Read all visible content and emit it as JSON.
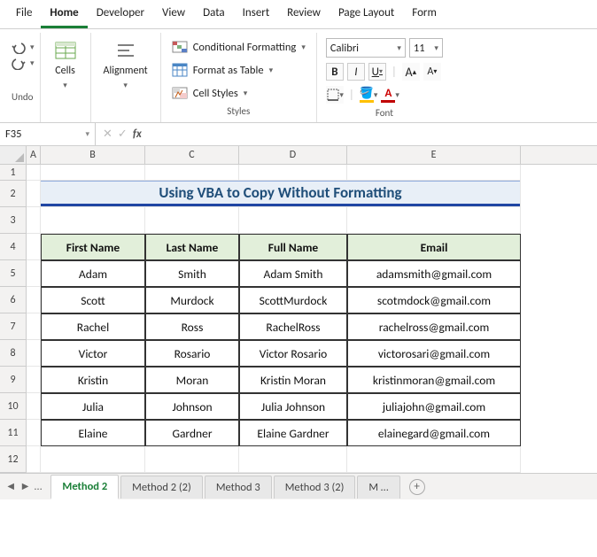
{
  "menu": [
    "File",
    "Home",
    "Developer",
    "View",
    "Data",
    "Insert",
    "Review",
    "Page Layout",
    "Form"
  ],
  "active_menu": "Home",
  "ribbon": {
    "undo": "Undo",
    "cells": "Cells",
    "alignment": "Alignment",
    "styles_label": "Styles",
    "cond_fmt": "Conditional Formatting",
    "fmt_table": "Format as Table",
    "cell_styles": "Cell Styles",
    "font_label": "Font",
    "font_name": "Calibri",
    "font_size": "11",
    "bold": "B",
    "italic": "I",
    "underline": "U"
  },
  "namebox": "F35",
  "columns": [
    "A",
    "B",
    "C",
    "D",
    "E"
  ],
  "row_nums": [
    "1",
    "2",
    "3",
    "4",
    "5",
    "6",
    "7",
    "8",
    "9",
    "10",
    "11",
    "12"
  ],
  "title": "Using VBA to Copy Without Formatting",
  "headers": [
    "First Name",
    "Last Name",
    "Full Name",
    "Email"
  ],
  "rows": [
    [
      "Adam",
      "Smith",
      "Adam Smith",
      "adamsmith@gmail.com"
    ],
    [
      "Scott",
      "Murdock",
      "ScottMurdock",
      "scotmdock@gmail.com"
    ],
    [
      "Rachel",
      "Ross",
      "RachelRoss",
      "rachelross@gmail.com"
    ],
    [
      "Victor",
      "Rosario",
      "Victor Rosario",
      "victorosari@gmail.com"
    ],
    [
      "Kristin",
      "Moran",
      "Kristin Moran",
      "kristinmoran@gmail.com"
    ],
    [
      "Julia",
      "Johnson",
      "Julia Johnson",
      "juliajohn@gmail.com"
    ],
    [
      "Elaine",
      "Gardner",
      "Elaine Gardner",
      "elainegard@gmail.com"
    ]
  ],
  "sheets": {
    "ellipsis": "…",
    "tabs": [
      "Method 2",
      "Method 2 (2)",
      "Method 3",
      "Method 3 (2)",
      "M …"
    ],
    "active": "Method 2"
  },
  "chart_data": {
    "type": "table",
    "title": "Using VBA to Copy Without Formatting",
    "columns": [
      "First Name",
      "Last Name",
      "Full Name",
      "Email"
    ],
    "rows": [
      [
        "Adam",
        "Smith",
        "Adam Smith",
        "adamsmith@gmail.com"
      ],
      [
        "Scott",
        "Murdock",
        "ScottMurdock",
        "scotmdock@gmail.com"
      ],
      [
        "Rachel",
        "Ross",
        "RachelRoss",
        "rachelross@gmail.com"
      ],
      [
        "Victor",
        "Rosario",
        "Victor Rosario",
        "victorosari@gmail.com"
      ],
      [
        "Kristin",
        "Moran",
        "Kristin Moran",
        "kristinmoran@gmail.com"
      ],
      [
        "Julia",
        "Johnson",
        "Julia Johnson",
        "juliajohn@gmail.com"
      ],
      [
        "Elaine",
        "Gardner",
        "Elaine Gardner",
        "elainegard@gmail.com"
      ]
    ]
  }
}
